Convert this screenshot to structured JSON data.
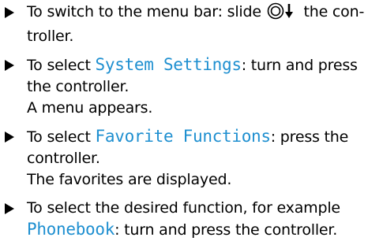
{
  "steps": [
    {
      "before": "To switch to the menu bar: slide ",
      "icon": "controller-slide-down-icon",
      "after": " the con- troller."
    },
    {
      "prefix": "To select ",
      "display": "System Settings",
      "suffix": ": turn and press the controller.",
      "result": "A menu appears."
    },
    {
      "prefix": "To select ",
      "display": "Favorite Functions",
      "suffix": ": press the controller.",
      "result": "The favorites are displayed."
    },
    {
      "prefix": "To select the desired function, for example ",
      "display": "Phonebook",
      "suffix": ": turn and press the controller."
    }
  ],
  "colors": {
    "display_text": "#1e8fd0",
    "body_text": "#000000"
  }
}
